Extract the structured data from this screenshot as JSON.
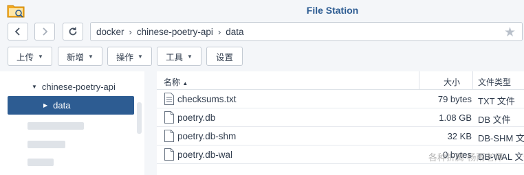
{
  "window": {
    "title": "File Station",
    "app_icon": "folder-icon"
  },
  "nav": {
    "back_icon": "chevron-left-icon",
    "forward_icon": "chevron-right-icon",
    "refresh_icon": "refresh-icon",
    "breadcrumb": [
      "docker",
      "chinese-poetry-api",
      "data"
    ],
    "separator": "›",
    "favorite_icon": "star-icon",
    "favorite_glyph": "★"
  },
  "toolbar": {
    "upload": "上传",
    "create": "新增",
    "action": "操作",
    "tools": "工具",
    "settings": "设置"
  },
  "tree": {
    "parent": "chinese-poetry-api",
    "selected": "data"
  },
  "list": {
    "headers": {
      "name": "名称",
      "size": "大小",
      "type": "文件类型"
    },
    "sort_indicator": "▲",
    "rows": [
      {
        "name": "checksums.txt",
        "size": "79 bytes",
        "type": "TXT 文件",
        "icon": "text-file-icon"
      },
      {
        "name": "poetry.db",
        "size": "1.08 GB",
        "type": "DB 文件",
        "icon": "file-icon"
      },
      {
        "name": "poetry.db-shm",
        "size": "32 KB",
        "type": "DB-SHM 文件",
        "icon": "file-icon"
      },
      {
        "name": "poetry.db-wal",
        "size": "0 bytes",
        "type": "DB-WAL 文件",
        "icon": "file-icon"
      }
    ]
  },
  "watermark": "各种折腾·杨雨老师",
  "colors": {
    "accent": "#2d5c92",
    "title": "#2d5c92",
    "background": "#f4f6f9"
  }
}
